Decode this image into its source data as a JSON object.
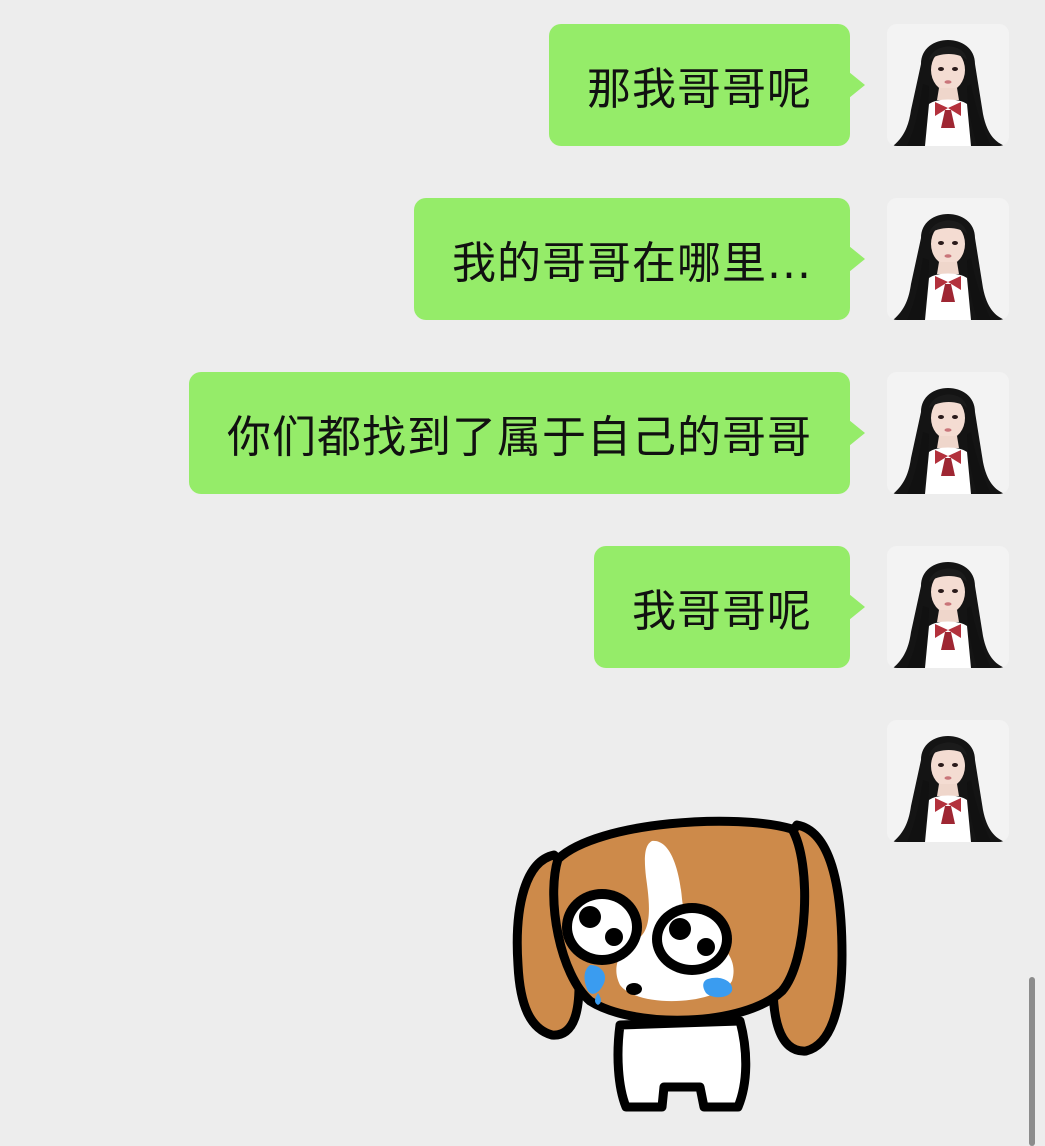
{
  "chat": {
    "messages": [
      {
        "text": "那我哥哥呢"
      },
      {
        "text": "我的哥哥在哪里..."
      },
      {
        "text": "你们都找到了属于自己的哥哥"
      },
      {
        "text": "我哥哥呢"
      }
    ]
  },
  "icons": {
    "avatar": "user-avatar-photo",
    "sticker": "crying-puppy-sticker"
  },
  "colors": {
    "background": "#ededed",
    "bubble": "#95ec69",
    "text": "#111111"
  }
}
